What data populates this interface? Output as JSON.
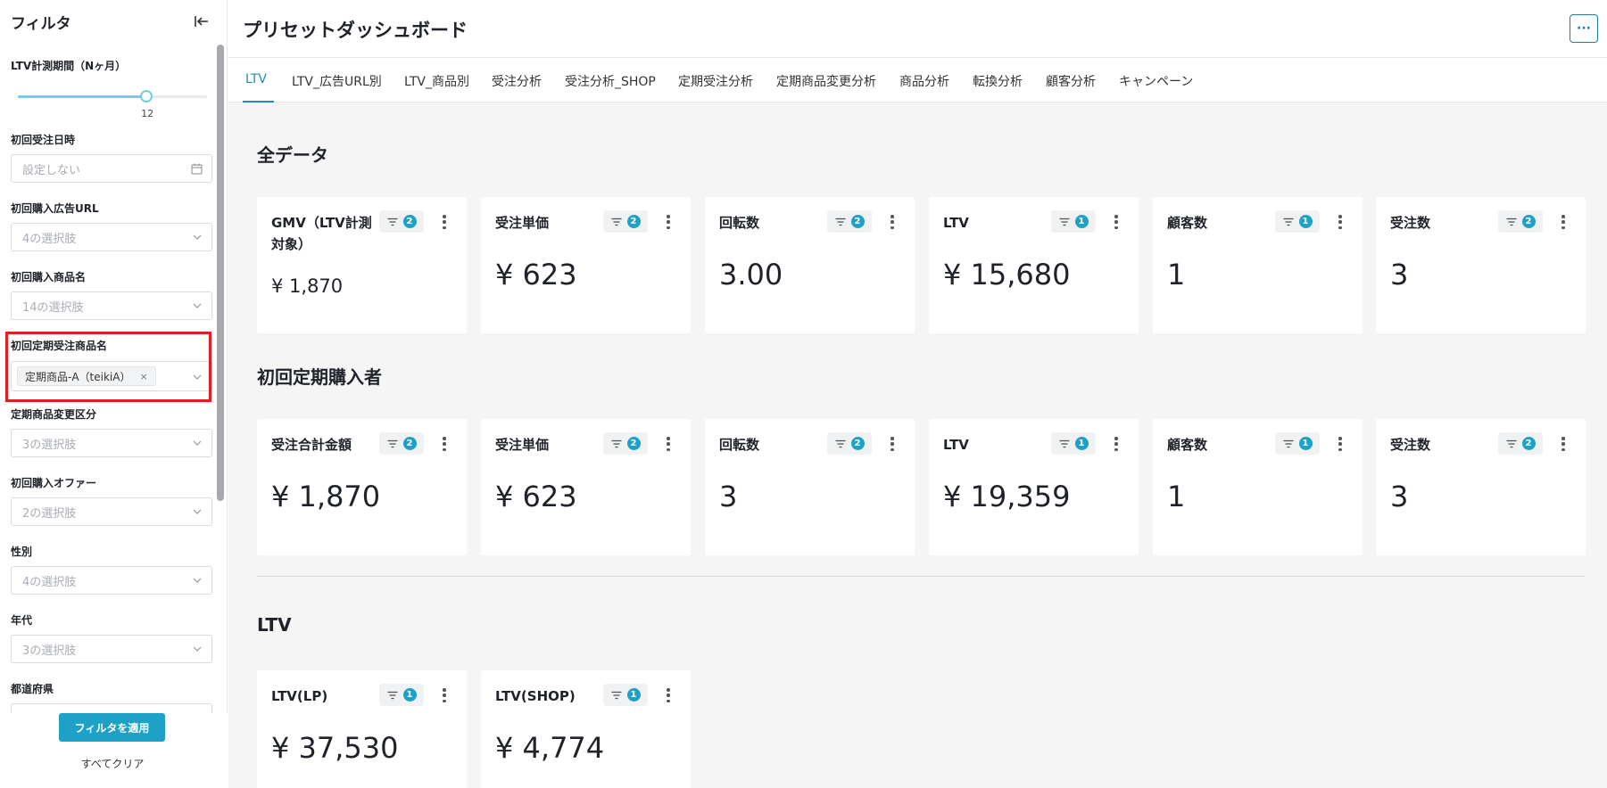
{
  "sidebar": {
    "title": "フィルタ",
    "ltv_period": {
      "label": "LTV計測期間（Nヶ月）",
      "value": "12",
      "fraction": 0.68
    },
    "filters": [
      {
        "label": "初回受注日時",
        "placeholder": "設定しない",
        "icon": "calendar-icon"
      },
      {
        "label": "初回購入広告URL",
        "placeholder": "4の選択肢"
      },
      {
        "label": "初回購入商品名",
        "placeholder": "14の選択肢"
      },
      {
        "label": "初回定期受注商品名",
        "tag": "定期商品-A（teikiA）",
        "tag_close": "×"
      },
      {
        "label": "定期商品変更区分",
        "placeholder": "3の選択肢"
      },
      {
        "label": "初回購入オファー",
        "placeholder": "2の選択肢"
      },
      {
        "label": "性別",
        "placeholder": "4の選択肢"
      },
      {
        "label": "年代",
        "placeholder": "3の選択肢"
      },
      {
        "label": "都道府県"
      }
    ],
    "apply_label": "フィルタを適用",
    "clear_label": "すべてクリア"
  },
  "header": {
    "title": "プリセットダッシュボード",
    "more_label": "···"
  },
  "tabs": [
    {
      "label": "LTV",
      "active": true
    },
    {
      "label": "LTV_広告URL別"
    },
    {
      "label": "LTV_商品別"
    },
    {
      "label": "受注分析"
    },
    {
      "label": "受注分析_SHOP"
    },
    {
      "label": "定期受注分析"
    },
    {
      "label": "定期商品変更分析"
    },
    {
      "label": "商品分析"
    },
    {
      "label": "転換分析"
    },
    {
      "label": "顧客分析"
    },
    {
      "label": "キャンペーン"
    }
  ],
  "sections": [
    {
      "title": "全データ",
      "cards": [
        {
          "title": "GMV（LTV計測対象）",
          "badge": "2",
          "value": "¥ 1,870"
        },
        {
          "title": "受注単価",
          "badge": "2",
          "value": "¥ 623"
        },
        {
          "title": "回転数",
          "badge": "2",
          "value": "3.00"
        },
        {
          "title": "LTV",
          "badge": "1",
          "value": "¥ 15,680"
        },
        {
          "title": "顧客数",
          "badge": "1",
          "value": "1"
        },
        {
          "title": "受注数",
          "badge": "2",
          "value": "3"
        }
      ]
    },
    {
      "title": "初回定期購入者",
      "cards": [
        {
          "title": "受注合計金額",
          "badge": "2",
          "value": "¥ 1,870"
        },
        {
          "title": "受注単価",
          "badge": "2",
          "value": "¥ 623"
        },
        {
          "title": "回転数",
          "badge": "2",
          "value": "3"
        },
        {
          "title": "LTV",
          "badge": "1",
          "value": "¥ 19,359"
        },
        {
          "title": "顧客数",
          "badge": "1",
          "value": "1"
        },
        {
          "title": "受注数",
          "badge": "2",
          "value": "3"
        }
      ]
    },
    {
      "title": "LTV",
      "cards": [
        {
          "title": "LTV(LP)",
          "badge": "1",
          "value": "¥ 37,530"
        },
        {
          "title": "LTV(SHOP)",
          "badge": "1",
          "value": "¥ 4,774"
        }
      ]
    }
  ],
  "colors": {
    "accent": "#1da1c7",
    "highlight": "#e02020",
    "slider": "#72cfe0"
  }
}
